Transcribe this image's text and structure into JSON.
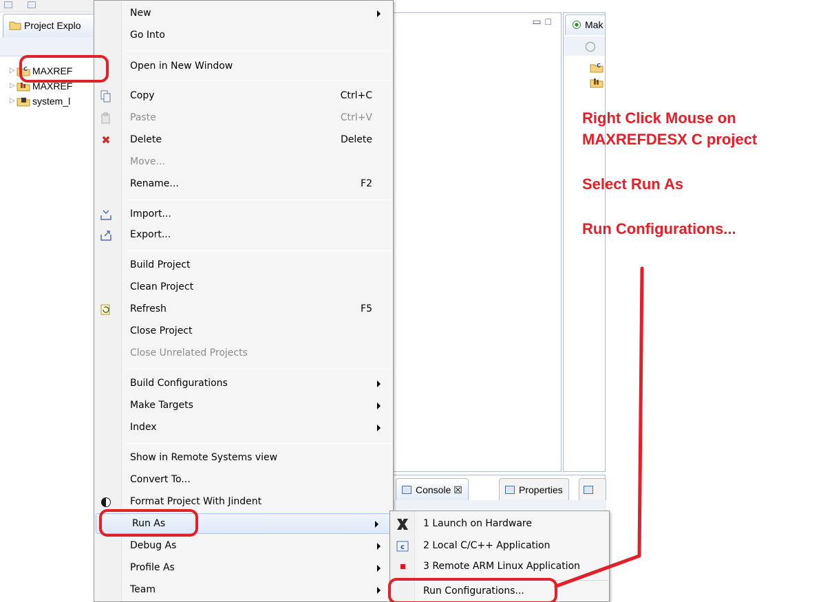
{
  "explorer": {
    "tab_label": "Project Explo",
    "tree": [
      {
        "label": "MAXREF"
      },
      {
        "label": "MAXREF"
      },
      {
        "label": "system_l"
      }
    ]
  },
  "outline": {
    "tab_label": "Mak"
  },
  "bottom_panel": {
    "tabs": [
      {
        "label": "Console ☒"
      },
      {
        "label": "Properties"
      }
    ]
  },
  "context_menu": {
    "items": [
      {
        "label": "New",
        "shortcut": "",
        "submenu": true
      },
      {
        "label": "Go Into",
        "shortcut": ""
      },
      {
        "label": "Open in New Window",
        "shortcut": ""
      },
      {
        "label": "Copy",
        "shortcut": "Ctrl+C",
        "icon": "copy-icon"
      },
      {
        "label": "Paste",
        "shortcut": "Ctrl+V",
        "icon": "paste-icon",
        "disabled": true
      },
      {
        "label": "Delete",
        "shortcut": "Delete",
        "icon": "delete-icon"
      },
      {
        "label": "Move...",
        "shortcut": "",
        "disabled": true
      },
      {
        "label": "Rename...",
        "shortcut": "F2"
      },
      {
        "label": "Import...",
        "shortcut": "",
        "icon": "import-icon"
      },
      {
        "label": "Export...",
        "shortcut": "",
        "icon": "export-icon"
      },
      {
        "label": "Build Project",
        "shortcut": ""
      },
      {
        "label": "Clean Project",
        "shortcut": ""
      },
      {
        "label": "Refresh",
        "shortcut": "F5",
        "icon": "refresh-icon"
      },
      {
        "label": "Close Project",
        "shortcut": ""
      },
      {
        "label": "Close Unrelated Projects",
        "shortcut": "",
        "disabled": true
      },
      {
        "label": "Build Configurations",
        "submenu": true
      },
      {
        "label": "Make Targets",
        "submenu": true
      },
      {
        "label": "Index",
        "submenu": true
      },
      {
        "label": "Show in Remote Systems view"
      },
      {
        "label": "Convert To..."
      },
      {
        "label": "Format Project With Jindent",
        "icon": "jindent-icon"
      },
      {
        "label": "Run As",
        "submenu": true,
        "highlighted": true
      },
      {
        "label": "Debug As",
        "submenu": true
      },
      {
        "label": "Profile As",
        "submenu": true
      },
      {
        "label": "Team",
        "submenu": true
      }
    ]
  },
  "run_as_submenu": {
    "items": [
      {
        "label": "1 Launch on Hardware",
        "icon": "xilinx-icon"
      },
      {
        "label": "2 Local C/C++ Application",
        "icon": "c-app-icon"
      },
      {
        "label": "3 Remote ARM Linux Application",
        "icon": "remote-app-icon"
      },
      {
        "label": "Run Configurations...",
        "icon": ""
      }
    ]
  },
  "annotation": {
    "color": "#e2202a",
    "lines": [
      "Right Click Mouse on",
      "MAXREFDESX C project",
      "Select Run As",
      "Run Configurations..."
    ]
  }
}
